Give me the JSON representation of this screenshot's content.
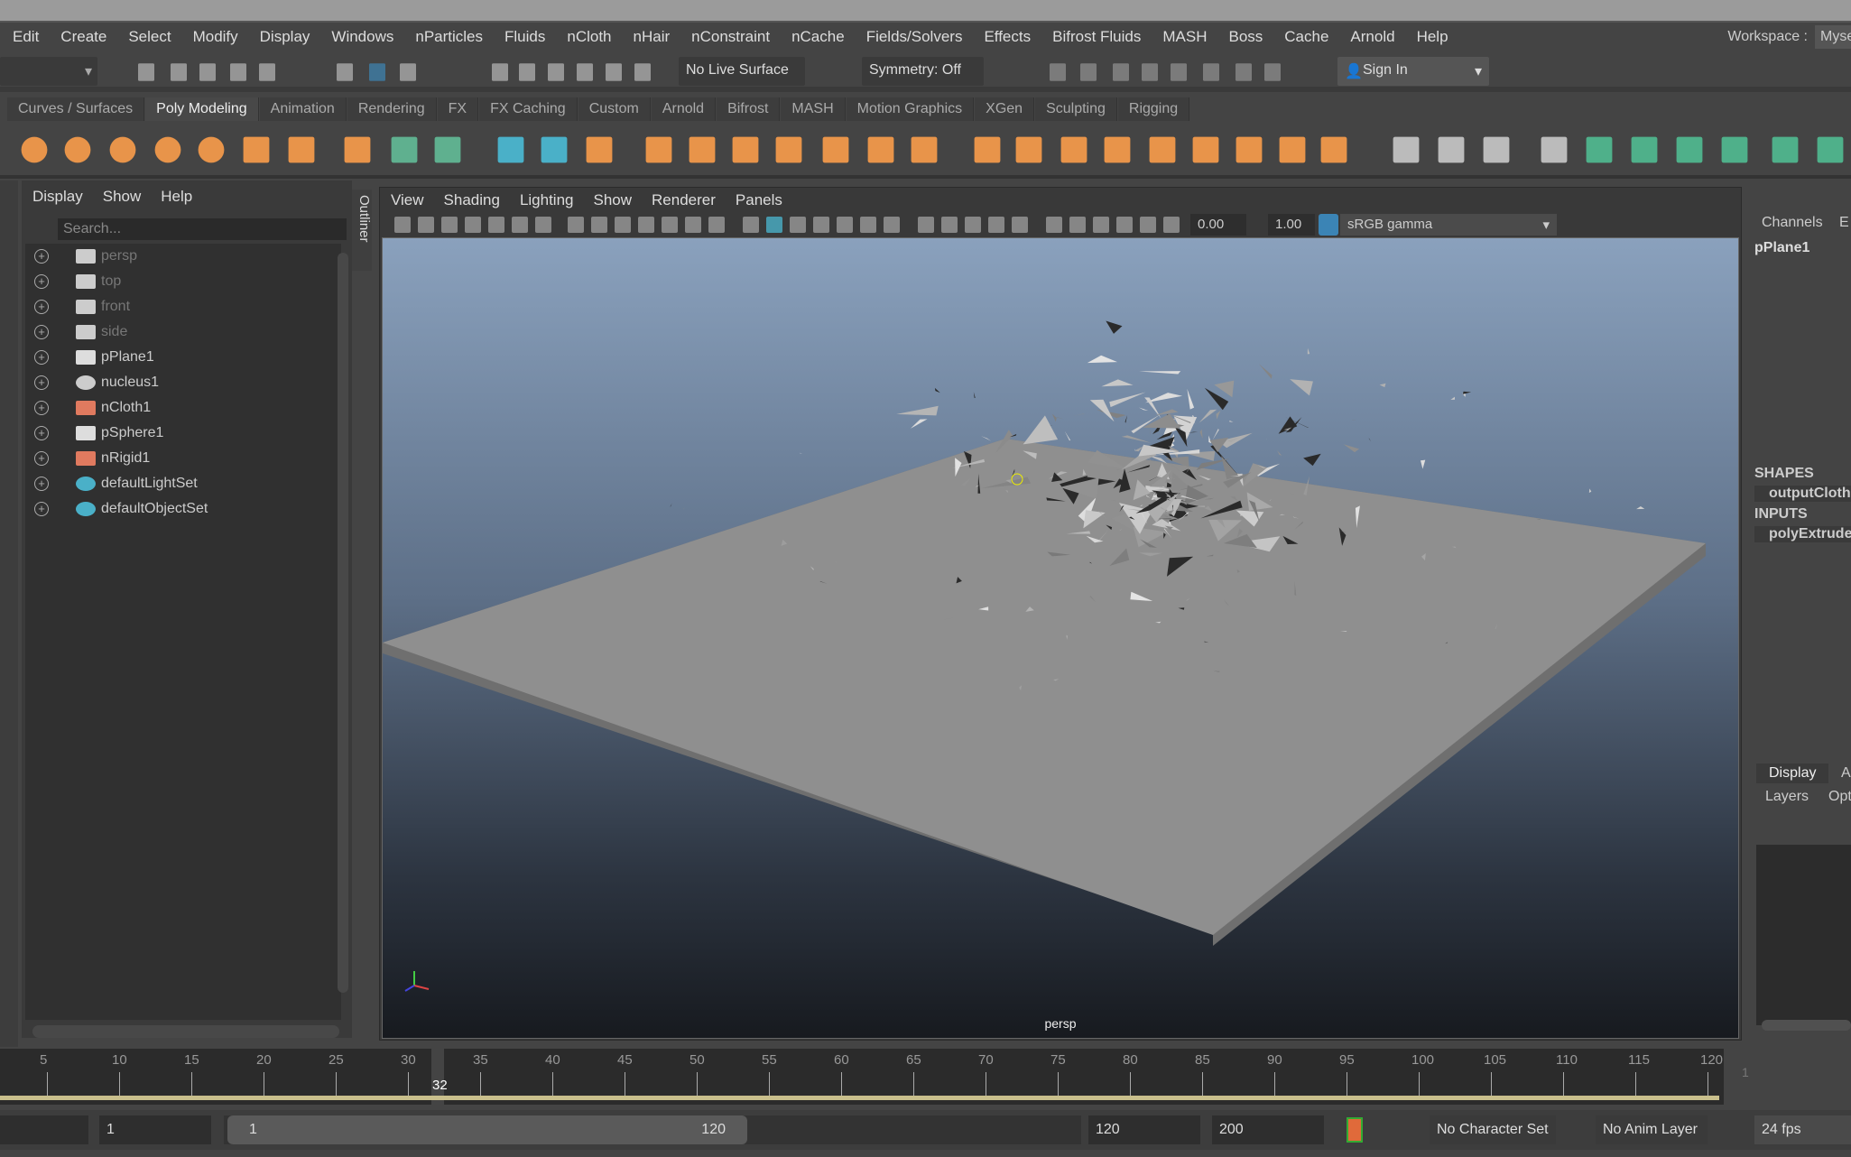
{
  "menubar": {
    "items": [
      "Edit",
      "Create",
      "Select",
      "Modify",
      "Display",
      "Windows",
      "nParticles",
      "Fluids",
      "nCloth",
      "nHair",
      "nConstraint",
      "nCache",
      "Fields/Solvers",
      "Effects",
      "Bifrost Fluids",
      "MASH",
      "Boss",
      "Cache",
      "Arnold",
      "Help"
    ],
    "workspace_label": "Workspace :",
    "workspace_value": "Myself"
  },
  "statusline": {
    "live_surface": "No Live Surface",
    "symmetry": "Symmetry: Off",
    "sign_in": "Sign In"
  },
  "shelf": {
    "tabs": [
      "Curves / Surfaces",
      "Poly Modeling",
      "Animation",
      "Rendering",
      "FX",
      "FX Caching",
      "Custom",
      "Arnold",
      "Bifrost",
      "MASH",
      "Motion Graphics",
      "XGen",
      "Sculpting",
      "Rigging"
    ],
    "active_tab": "Poly Modeling",
    "icons": [
      "poly-sphere-icon",
      "poly-cube-icon",
      "poly-torus-icon",
      "poly-cone-icon",
      "poly-cylinder-icon",
      "poly-plane-icon",
      "poly-text-icon",
      "svg-icon",
      "sphere-type-icon",
      "super-shape-icon",
      "pivot-icon",
      "timer-icon",
      "freeze-transform-icon",
      "combine-icon",
      "separate-icon",
      "mirror-icon",
      "smooth-icon",
      "reduce-icon",
      "boolean-union-icon",
      "boolean-diff-icon",
      "extrude-icon",
      "bridge-icon",
      "bevel-icon",
      "append-icon",
      "fill-hole-icon",
      "circularize-icon",
      "wedge-icon",
      "merge-icon",
      "collapse-icon",
      "bevel-edge-icon",
      "multi-cut-icon",
      "edge-loop-icon",
      "insert-loop-icon",
      "planar-uv-icon",
      "cylindrical-uv-icon",
      "spherical-uv-icon",
      "automatic-uv-icon",
      "cut-uv-icon",
      "mash-icon",
      "curve-warp-icon"
    ]
  },
  "outliner": {
    "menu": [
      "Display",
      "Show",
      "Help"
    ],
    "search_placeholder": "Search...",
    "tab_label": "Outliner",
    "items": [
      {
        "name": "persp",
        "icon": "camera-icon",
        "dim": true
      },
      {
        "name": "top",
        "icon": "camera-icon",
        "dim": true
      },
      {
        "name": "front",
        "icon": "camera-icon",
        "dim": true
      },
      {
        "name": "side",
        "icon": "camera-icon",
        "dim": true
      },
      {
        "name": "pPlane1",
        "icon": "mesh-icon"
      },
      {
        "name": "nucleus1",
        "icon": "nucleus-icon"
      },
      {
        "name": "nCloth1",
        "icon": "ncloth-icon"
      },
      {
        "name": "pSphere1",
        "icon": "mesh-icon"
      },
      {
        "name": "nRigid1",
        "icon": "nrigid-icon"
      },
      {
        "name": "defaultLightSet",
        "icon": "set-icon"
      },
      {
        "name": "defaultObjectSet",
        "icon": "set-icon"
      }
    ]
  },
  "viewport": {
    "menu": [
      "View",
      "Shading",
      "Lighting",
      "Show",
      "Renderer",
      "Panels"
    ],
    "exposure": "0.00",
    "gamma": "1.00",
    "color_space": "sRGB gamma",
    "camera": "persp",
    "colors": {
      "plane": "#8f8f8f",
      "sky_top": "#8aa1bd"
    }
  },
  "channelbox": {
    "tabs": [
      "Channels",
      "E"
    ],
    "object": "pPlane1",
    "shapes_header": "SHAPES",
    "shape": "outputCloth",
    "inputs_header": "INPUTS",
    "input": "polyExtrude",
    "layer_tabs": [
      "Display",
      "A"
    ],
    "layer_menu": [
      "Layers",
      "Opt"
    ]
  },
  "timeline": {
    "ticks": [
      5,
      10,
      15,
      20,
      25,
      30,
      35,
      40,
      45,
      50,
      55,
      60,
      65,
      70,
      75,
      80,
      85,
      90,
      95,
      100,
      105,
      110,
      115,
      120
    ],
    "current_frame": "32",
    "right_value": "1"
  },
  "range": {
    "start": "1",
    "range_start": "1",
    "range_end": "120",
    "end": "120",
    "max_end": "200",
    "character_set": "No Character Set",
    "anim_layer": "No Anim Layer",
    "fps": "24 fps"
  }
}
